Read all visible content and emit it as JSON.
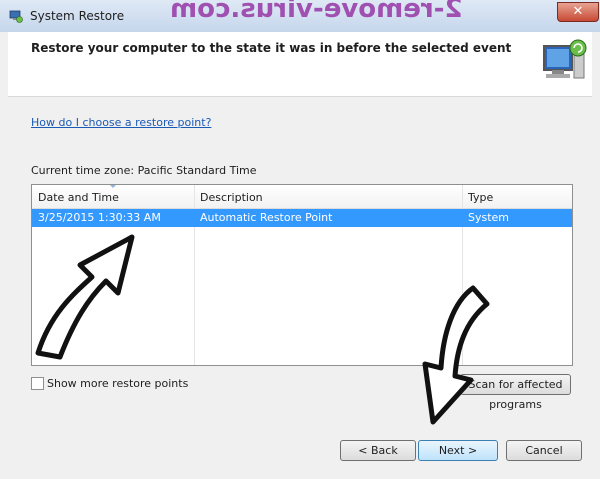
{
  "window": {
    "title": "System Restore",
    "close_glyph": "✕"
  },
  "watermark": "2-remove-virus.com",
  "header": {
    "heading": "Restore your computer to the state it was in before the selected event",
    "icon": "system-restore-computer-icon"
  },
  "content": {
    "help_link": "How do I choose a restore point?",
    "timezone": "Current time zone: Pacific Standard Time",
    "table": {
      "columns": [
        "Date and Time",
        "Description",
        "Type"
      ],
      "rows": [
        {
          "date": "3/25/2015 1:30:33 AM",
          "description": "Automatic Restore Point",
          "type": "System",
          "selected": true
        }
      ]
    },
    "show_more_label": "Show more restore points",
    "show_more_checked": false,
    "affected_label": "Scan for affected programs"
  },
  "buttons": {
    "back": "< Back",
    "next": "Next >",
    "cancel": "Cancel"
  },
  "colors": {
    "selection": "#3399ff",
    "link": "#1b5ab4",
    "watermark": "#a050b0"
  }
}
